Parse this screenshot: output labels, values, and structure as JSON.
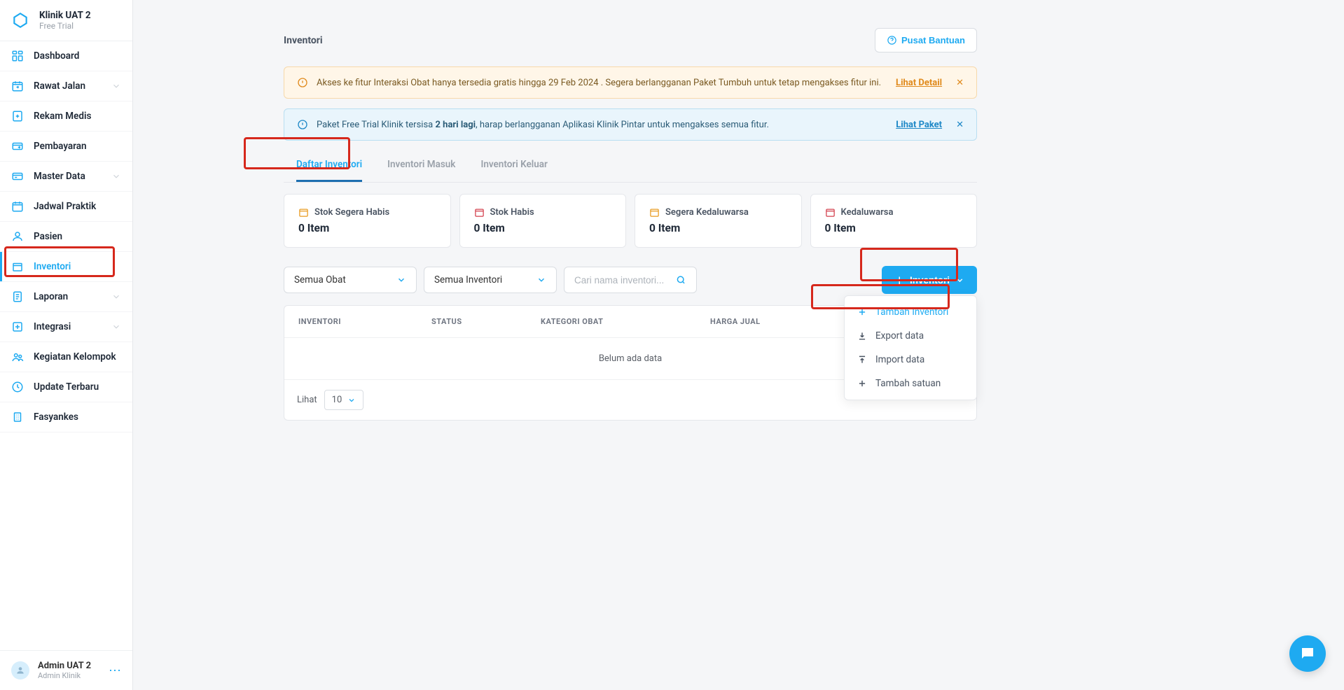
{
  "brand": {
    "clinic_name": "Klinik UAT 2",
    "clinic_sub": "Free Trial"
  },
  "sidebar": {
    "items": [
      {
        "label": "Dashboard",
        "icon": "dashboard",
        "expandable": false
      },
      {
        "label": "Rawat Jalan",
        "icon": "calendar-arrow",
        "expandable": true
      },
      {
        "label": "Rekam Medis",
        "icon": "doc-plus",
        "expandable": false
      },
      {
        "label": "Pembayaran",
        "icon": "card-arrow",
        "expandable": false
      },
      {
        "label": "Master Data",
        "icon": "card",
        "expandable": true
      },
      {
        "label": "Jadwal Praktik",
        "icon": "calendar",
        "expandable": false
      },
      {
        "label": "Pasien",
        "icon": "person",
        "expandable": false
      },
      {
        "label": "Inventori",
        "icon": "box",
        "expandable": false,
        "active": true
      },
      {
        "label": "Laporan",
        "icon": "report",
        "expandable": true
      },
      {
        "label": "Integrasi",
        "icon": "integration",
        "expandable": true
      },
      {
        "label": "Kegiatan Kelompok",
        "icon": "group",
        "expandable": false
      },
      {
        "label": "Update Terbaru",
        "icon": "clock",
        "expandable": false
      },
      {
        "label": "Fasyankes",
        "icon": "building",
        "expandable": false
      }
    ]
  },
  "user": {
    "name": "Admin UAT 2",
    "role": "Admin Klinik"
  },
  "page": {
    "title": "Inventori",
    "help_btn": "Pusat Bantuan"
  },
  "alerts": {
    "warn": {
      "text_a": "Akses ke fitur Interaksi Obat hanya tersedia gratis hingga 29 Feb 2024 . Segera berlangganan Paket Tumbuh untuk tetap mengakses fitur ini.",
      "link": "Lihat Detail"
    },
    "info": {
      "text_a": "Paket Free Trial Klinik tersisa ",
      "bold": "2 hari lagi",
      "text_b": ", harap berlangganan Aplikasi Klinik Pintar untuk mengakses semua fitur.",
      "link": "Lihat Paket"
    }
  },
  "tabs": [
    {
      "label": "Daftar Inventori",
      "active": true
    },
    {
      "label": "Inventori Masuk",
      "active": false
    },
    {
      "label": "Inventori Keluar",
      "active": false
    }
  ],
  "cards": [
    {
      "title": "Stok Segera Habis",
      "value": "0 Item",
      "color": "#e89a1e"
    },
    {
      "title": "Stok Habis",
      "value": "0 Item",
      "color": "#d33f4c"
    },
    {
      "title": "Segera Kedaluwarsa",
      "value": "0 Item",
      "color": "#e89a1e"
    },
    {
      "title": "Kedaluwarsa",
      "value": "0 Item",
      "color": "#d33f4c"
    }
  ],
  "filters": {
    "select1": "Semua Obat",
    "select2": "Semua Inventori",
    "search_placeholder": "Cari nama inventori..."
  },
  "add_button": "Inventori",
  "dropdown": [
    {
      "label": "Tambah Inventori",
      "icon": "plus",
      "hl": true
    },
    {
      "label": "Export data",
      "icon": "download",
      "hl": false
    },
    {
      "label": "Import data",
      "icon": "upload",
      "hl": false
    },
    {
      "label": "Tambah satuan",
      "icon": "plus",
      "hl": false
    }
  ],
  "table": {
    "cols": [
      "INVENTORI",
      "STATUS",
      "KATEGORI OBAT",
      "HARGA JUAL"
    ],
    "empty": "Belum ada data",
    "show_label": "Lihat",
    "page_size": "10"
  }
}
